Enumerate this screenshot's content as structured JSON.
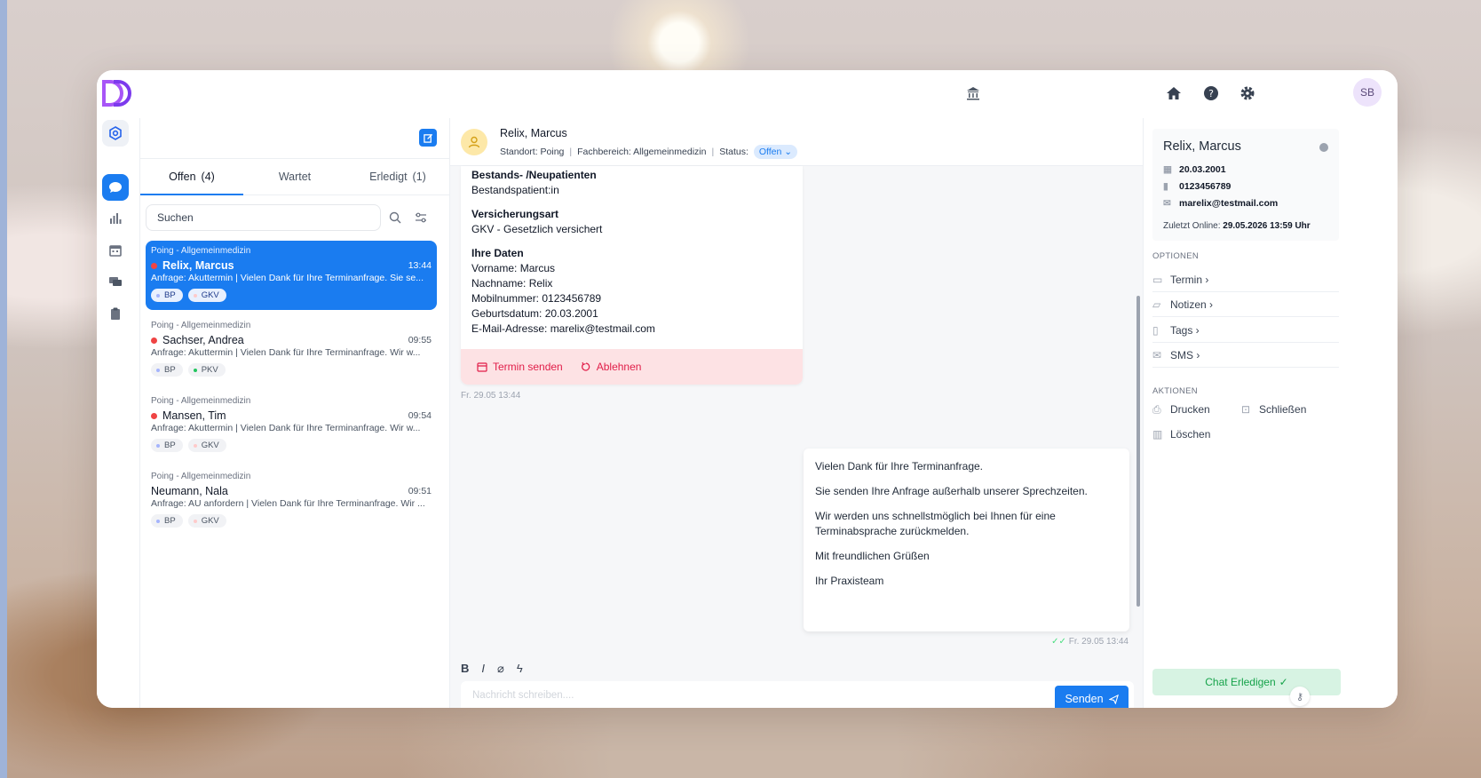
{
  "topbar": {
    "logo": "d-logo",
    "bank_icon": "bank-icon",
    "home_icon": "home-icon",
    "help_icon": "help-icon",
    "settings_icon": "gear-icon",
    "avatar_initials": "SB"
  },
  "list": {
    "tabs": [
      {
        "label": "Offen",
        "count": "(4)"
      },
      {
        "label": "Wartet",
        "count": ""
      },
      {
        "label": "Erledigt",
        "count": "(1)"
      }
    ],
    "search_placeholder": "Suchen",
    "conversations": [
      {
        "location": "Poing - Allgemeinmedizin",
        "name": "Relix, Marcus",
        "time": "13:44",
        "preview": "Anfrage: Akuttermin | Vielen Dank für Ihre Terminanfrage. Sie se...",
        "chips": [
          "BP",
          "GKV"
        ],
        "unread": true
      },
      {
        "location": "Poing - Allgemeinmedizin",
        "name": "Sachser, Andrea",
        "time": "09:55",
        "preview": "Anfrage: Akuttermin | Vielen Dank für Ihre Terminanfrage. Wir w...",
        "chips": [
          "BP",
          "PKV"
        ],
        "unread": true
      },
      {
        "location": "Poing - Allgemeinmedizin",
        "name": "Mansen, Tim",
        "time": "09:54",
        "preview": "Anfrage: Akuttermin | Vielen Dank für Ihre Terminanfrage. Wir w...",
        "chips": [
          "BP",
          "GKV"
        ],
        "unread": true
      },
      {
        "location": "Poing - Allgemeinmedizin",
        "name": "Neumann, Nala",
        "time": "09:51",
        "preview": "Anfrage: AU anfordern | Vielen Dank für Ihre Terminanfrage. Wir ...",
        "chips": [
          "BP",
          "GKV"
        ],
        "unread": false
      }
    ]
  },
  "chat": {
    "name": "Relix, Marcus",
    "standort": "Standort: Poing",
    "fachbereich": "Fachbereich: Allgemeinmedizin",
    "status_label": "Status:",
    "status_value": "Offen",
    "card": {
      "sec1_title": "Bestands- /Neupatienten",
      "sec1_value": "Bestandspatient:in",
      "sec2_title": "Versicherungsart",
      "sec2_value": "GKV - Gesetzlich versichert",
      "sec3_title": "Ihre Daten",
      "lines": [
        "Vorname: Marcus",
        "Nachname: Relix",
        "Mobilnummer: 0123456789",
        "Geburtsdatum: 20.03.2001",
        "E-Mail-Adresse: marelix@testmail.com"
      ],
      "action_send": "Termin senden",
      "action_decline": "Ablehnen"
    },
    "in_time": "Fr. 29.05 13:44",
    "reply": [
      "Vielen Dank für Ihre Terminanfrage.",
      "Sie senden Ihre Anfrage außerhalb unserer Sprechzeiten.",
      "Wir werden uns schnellstmöglich bei Ihnen für eine Terminabsprache zurückmelden.",
      "Mit freundlichen Grüßen",
      "Ihr Praxisteam"
    ],
    "out_time": "Fr. 29.05 13:44",
    "composer_placeholder": "Nachricht schreiben....",
    "send_label": "Senden"
  },
  "detail": {
    "name": "Relix, Marcus",
    "birthdate": "20.03.2001",
    "phone": "0123456789",
    "email": "marelix@testmail.com",
    "online_label": "Zuletzt Online:",
    "online_value": "29.05.2026 13:59 Uhr",
    "options_label": "OPTIONEN",
    "options": [
      "Termin ›",
      "Notizen ›",
      "Tags ›",
      "SMS ›"
    ],
    "actions_label": "AKTIONEN",
    "print": "Drucken",
    "close": "Schließen",
    "delete": "Löschen",
    "done": "Chat Erledigen"
  }
}
